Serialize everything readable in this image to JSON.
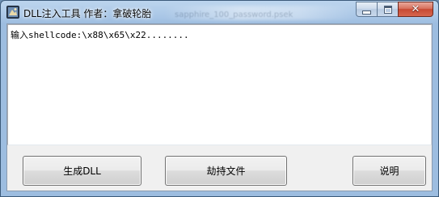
{
  "window": {
    "title": "DLL注入工具 作者：拿破轮胎",
    "background_blur_text": "sapphire_100_password.psek"
  },
  "caption": {
    "minimize_icon": "minimize-icon",
    "maximize_icon": "maximize-icon",
    "close_glyph": "✕"
  },
  "editor": {
    "content": "输入shellcode:\\x88\\x65\\x22........"
  },
  "buttons": {
    "generate_dll": "生成DLL",
    "hijack_file": "劫持文件",
    "help": "说明"
  },
  "colors": {
    "titlebar": "#a9c6e6",
    "close_button": "#c74a33",
    "client_bg": "#f0f0f0"
  }
}
